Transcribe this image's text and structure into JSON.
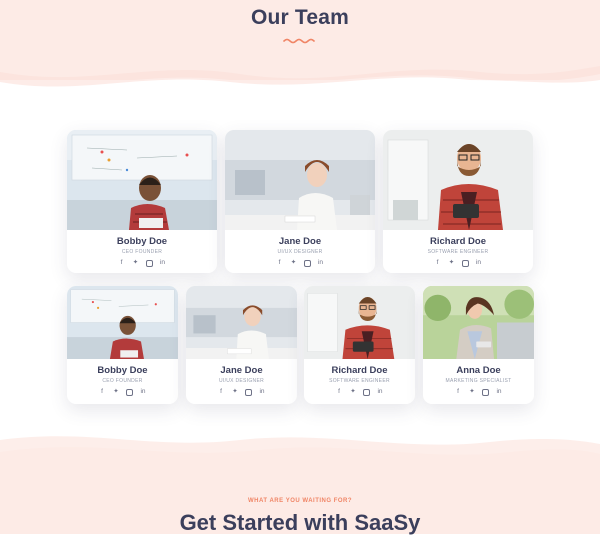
{
  "section": {
    "title": "Our Team"
  },
  "colors": {
    "accent": "#f08566",
    "heading": "#3b3f5c",
    "background_blush": "#fdebe6"
  },
  "team_rows": [
    [
      {
        "name": "Bobby Doe",
        "role": "CEO FOUNDER"
      },
      {
        "name": "Jane Doe",
        "role": "UI/UX DESIGNER"
      },
      {
        "name": "Richard Doe",
        "role": "SOFTWARE ENGINEER"
      }
    ],
    [
      {
        "name": "Bobby Doe",
        "role": "CEO FOUNDER"
      },
      {
        "name": "Jane Doe",
        "role": "UI/UX DESIGNER"
      },
      {
        "name": "Richard Doe",
        "role": "SOFTWARE ENGINEER"
      },
      {
        "name": "Anna Doe",
        "role": "MARKETING SPECIALIST"
      }
    ]
  ],
  "social_icons": [
    "facebook-icon",
    "twitter-icon",
    "instagram-icon",
    "linkedin-icon"
  ],
  "social_glyphs": {
    "facebook": "f",
    "twitter": "✦",
    "linkedin": "in"
  },
  "cta": {
    "eyebrow": "WHAT ARE YOU WAITING FOR?",
    "title": "Get Started with SaaSy"
  }
}
